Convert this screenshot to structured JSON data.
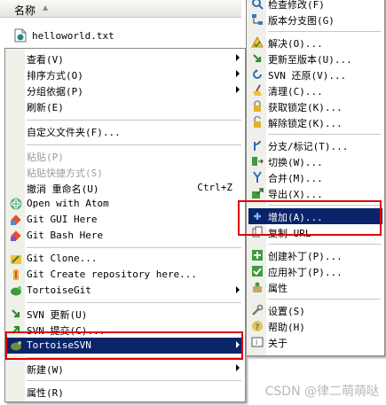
{
  "explorer": {
    "column_header": "名称",
    "file": "helloworld.txt"
  },
  "context_menu": {
    "items": [
      {
        "label": "查看(V)",
        "submenu": true
      },
      {
        "label": "排序方式(O)",
        "submenu": true
      },
      {
        "label": "分组依据(P)",
        "submenu": true
      },
      {
        "label": "刷新(E)"
      },
      {
        "label": "自定义文件夹(F)..."
      },
      {
        "label": "粘贴(P)",
        "disabled": true
      },
      {
        "label": "粘贴快捷方式(S)",
        "disabled": true
      },
      {
        "label": "撤消 重命名(U)",
        "shortcut": "Ctrl+Z"
      },
      {
        "label": "Open with Atom"
      },
      {
        "label": "Git GUI Here"
      },
      {
        "label": "Git Bash Here"
      },
      {
        "label": "Git Clone..."
      },
      {
        "label": "Git Create repository here..."
      },
      {
        "label": "TortoiseGit",
        "submenu": true
      },
      {
        "label": "SVN 更新(U)"
      },
      {
        "label": "SVN 提交(C)..."
      },
      {
        "label": "TortoiseSVN",
        "submenu": true,
        "highlighted": true
      },
      {
        "label": "新建(W)",
        "submenu": true
      },
      {
        "label": "属性(R)"
      }
    ]
  },
  "svn_submenu": {
    "items": [
      {
        "label": "检查修改(F)",
        "icon": "check-modifications-icon"
      },
      {
        "label": "版本分支图(G)",
        "icon": "revision-graph-icon"
      },
      {
        "label": "解决(O)...",
        "icon": "resolve-icon"
      },
      {
        "label": "更新至版本(U)...",
        "icon": "update-to-revision-icon"
      },
      {
        "label": "SVN 还原(V)...",
        "icon": "revert-icon"
      },
      {
        "label": "清理(C)...",
        "icon": "cleanup-icon"
      },
      {
        "label": "获取锁定(K)...",
        "icon": "lock-icon"
      },
      {
        "label": "解除锁定(K)...",
        "icon": "unlock-icon"
      },
      {
        "label": "分支/标记(T)...",
        "icon": "branch-icon"
      },
      {
        "label": "切换(W)...",
        "icon": "switch-icon"
      },
      {
        "label": "合并(M)...",
        "icon": "merge-icon"
      },
      {
        "label": "导出(X)...",
        "icon": "export-icon"
      },
      {
        "label": "增加(A)...",
        "icon": "add-icon",
        "highlighted": true
      },
      {
        "label": "复制 URL",
        "icon": "copy-url-icon"
      },
      {
        "label": "创建补丁(P)...",
        "icon": "create-patch-icon"
      },
      {
        "label": "应用补丁(P)...",
        "icon": "apply-patch-icon"
      },
      {
        "label": "属性",
        "icon": "properties-icon"
      },
      {
        "label": "设置(S)",
        "icon": "settings-icon"
      },
      {
        "label": "帮助(H)",
        "icon": "help-icon"
      },
      {
        "label": "关于",
        "icon": "about-icon"
      }
    ]
  },
  "watermark": "CSDN @律二萌萌哒",
  "colors": {
    "highlight": "#0a246a",
    "annotation_red": "#e00000",
    "disabled_text": "#9b9b9b"
  }
}
